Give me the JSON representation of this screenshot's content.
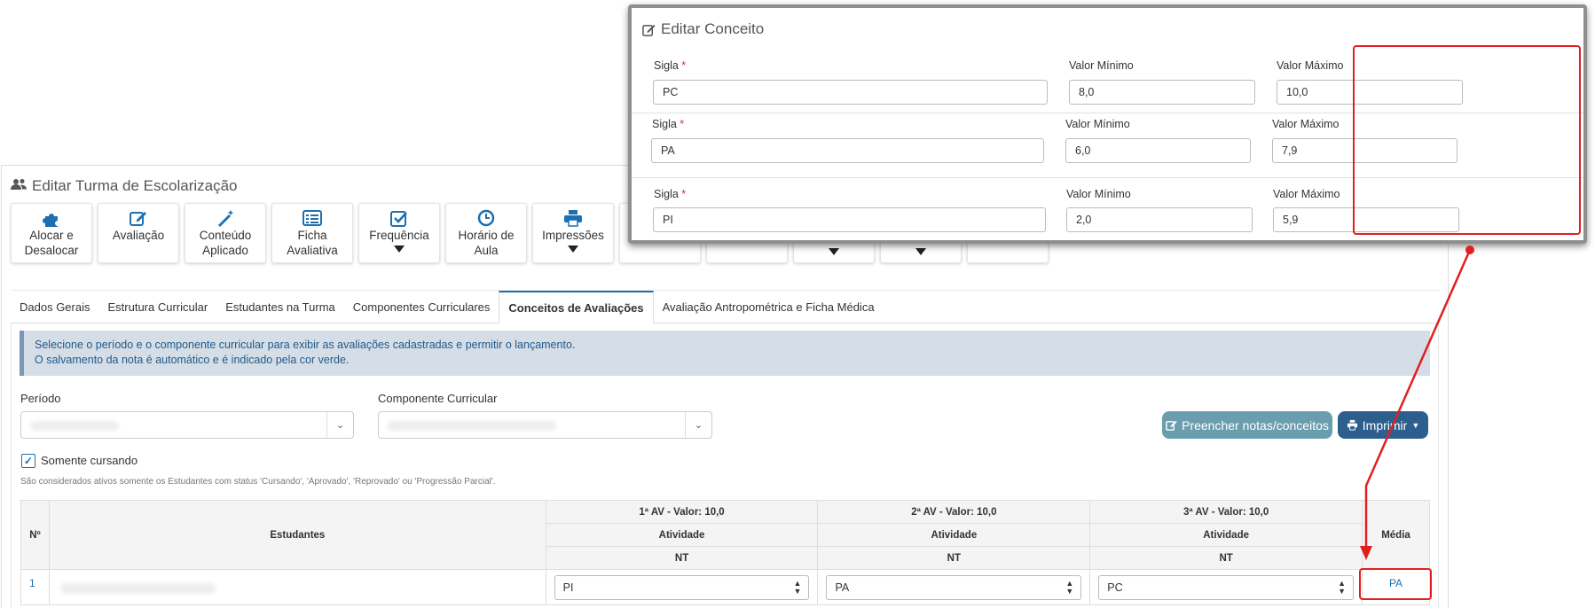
{
  "page": {
    "title": "Editar Turma de Escolarização",
    "toolbar": [
      {
        "icon": "puzzle-icon",
        "label_line1": "Alocar e",
        "label_line2": "Desalocar",
        "caret": false
      },
      {
        "icon": "edit-icon",
        "label_line1": "Avaliação",
        "label_line2": "",
        "caret": false
      },
      {
        "icon": "magic-wand-icon",
        "label_line1": "Conteúdo",
        "label_line2": "Aplicado",
        "caret": false
      },
      {
        "icon": "list-icon",
        "label_line1": "Ficha",
        "label_line2": "Avaliativa",
        "caret": false
      },
      {
        "icon": "check-square-icon",
        "label_line1": "Frequência",
        "label_line2": "",
        "caret": true
      },
      {
        "icon": "clock-icon",
        "label_line1": "Horário de",
        "label_line2": "Aula",
        "caret": false
      },
      {
        "icon": "printer-icon",
        "label_line1": "Impressões",
        "label_line2": "",
        "caret": true
      }
    ],
    "tabs": [
      "Dados Gerais",
      "Estrutura Curricular",
      "Estudantes na Turma",
      "Componentes Curriculares",
      "Conceitos de Avaliações",
      "Avaliação Antropométrica e Ficha Médica"
    ],
    "active_tab": "Conceitos de Avaliações",
    "info_line1": "Selecione o período e o componente curricular para exibir as avaliações cadastradas e permitir o lançamento.",
    "info_line2": "O salvamento da nota é automático e é indicado pela cor verde.",
    "periodo_label": "Período",
    "componente_label": "Componente Curricular",
    "fill_button": "Preencher notas/conceitos",
    "print_button": "Imprimir",
    "somente_cursando": "Somente cursando",
    "note": "São considerados ativos somente os Estudantes com status 'Cursando', 'Aprovado', 'Reprovado' ou 'Progressão Parcial'.",
    "table": {
      "col_num": "Nº",
      "col_students": "Estudantes",
      "col_media": "Média",
      "evaluations": [
        {
          "title": "1ª AV - Valor: 10,0",
          "type": "Atividade",
          "code": "NT"
        },
        {
          "title": "2ª AV - Valor: 10,0",
          "type": "Atividade",
          "code": "NT"
        },
        {
          "title": "3ª AV - Valor: 10,0",
          "type": "Atividade",
          "code": "NT"
        }
      ],
      "rows": [
        {
          "num": "1",
          "values": [
            "PI",
            "PA",
            "PC"
          ],
          "media": "PA"
        }
      ]
    }
  },
  "modal": {
    "title": "Editar Conceito",
    "sigla_label": "Sigla",
    "required_mark": "*",
    "min_label": "Valor Mínimo",
    "max_label": "Valor Máximo",
    "rows": [
      {
        "sigla": "PC",
        "min": "8,0",
        "max": "10,0"
      },
      {
        "sigla": "PA",
        "min": "6,0",
        "max": "7,9"
      },
      {
        "sigla": "PI",
        "min": "2,0",
        "max": "5,9"
      }
    ]
  },
  "colors": {
    "accent": "#1c6fb0",
    "annotation": "#e02020",
    "fill_button": "#6a9eae",
    "print_button": "#2c5f8e",
    "info_bg": "#d5dde6"
  }
}
